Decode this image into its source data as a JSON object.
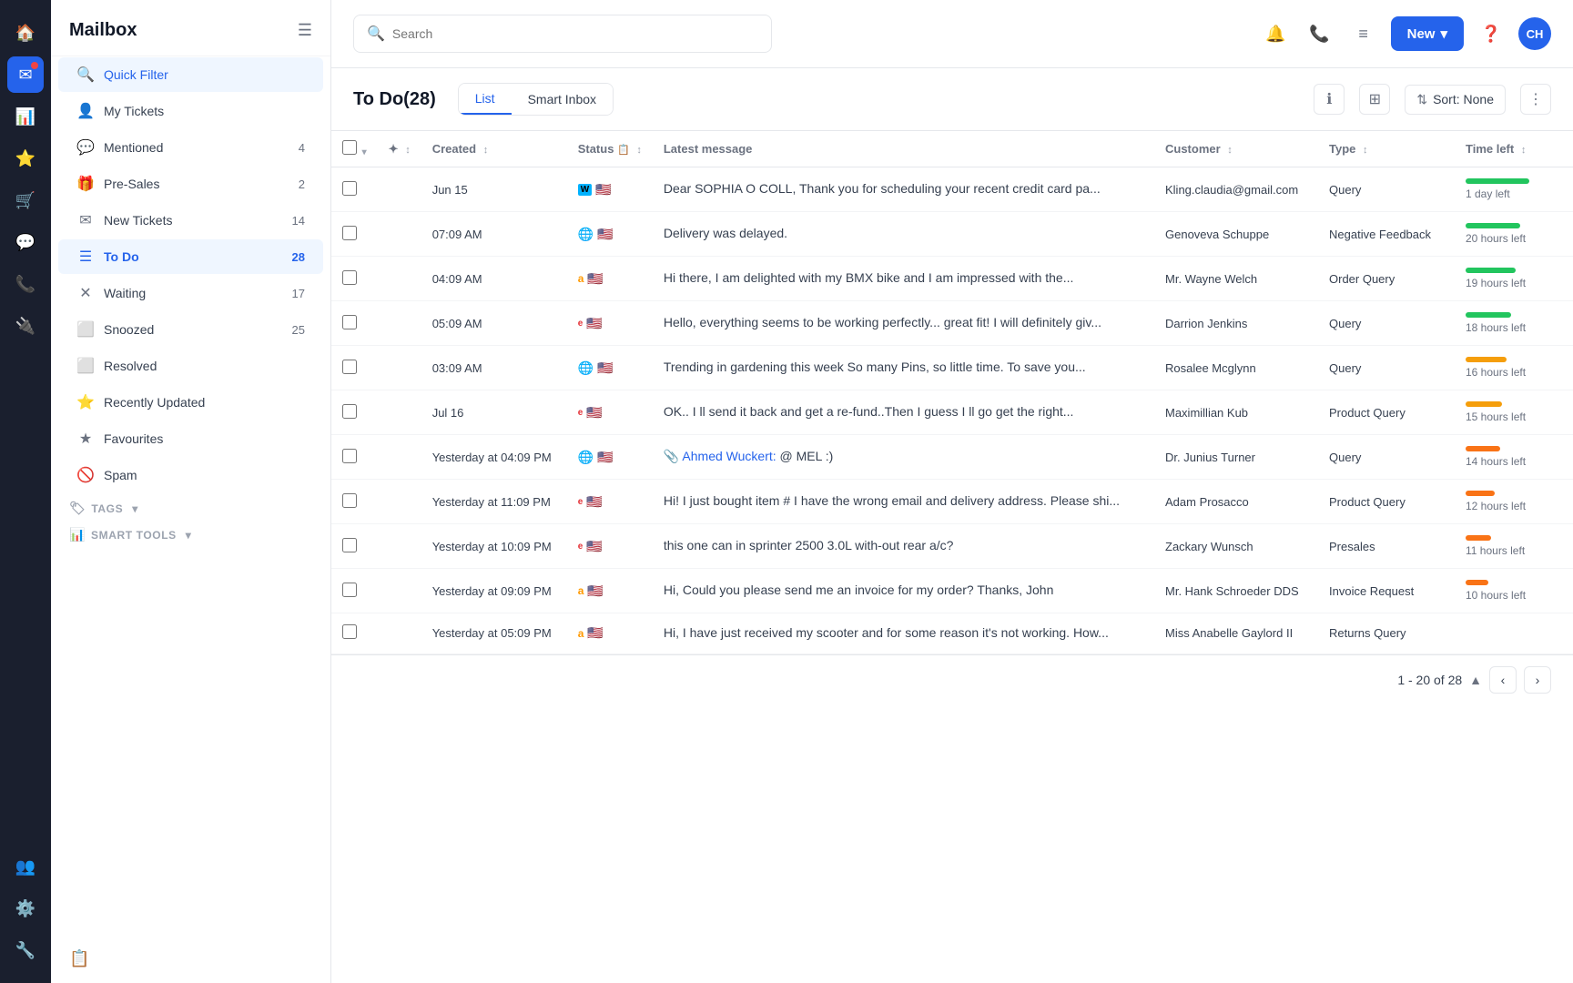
{
  "app": {
    "title": "Mailbox"
  },
  "sidebar": {
    "title": "Mailbox",
    "items": [
      {
        "id": "quick-filter",
        "label": "Quick Filter",
        "icon": "🔍",
        "count": "",
        "active": true
      },
      {
        "id": "my-tickets",
        "label": "My Tickets",
        "icon": "👤",
        "count": ""
      },
      {
        "id": "mentioned",
        "label": "Mentioned",
        "icon": "💬",
        "count": "4"
      },
      {
        "id": "pre-sales",
        "label": "Pre-Sales",
        "icon": "🎁",
        "count": "2"
      },
      {
        "id": "new-tickets",
        "label": "New Tickets",
        "icon": "✉️",
        "count": "14"
      },
      {
        "id": "to-do",
        "label": "To Do",
        "icon": "☰",
        "count": "28"
      },
      {
        "id": "waiting",
        "label": "Waiting",
        "icon": "✕",
        "count": "17"
      },
      {
        "id": "snoozed",
        "label": "Snoozed",
        "icon": "◻",
        "count": "25"
      },
      {
        "id": "resolved",
        "label": "Resolved",
        "icon": "◻",
        "count": ""
      },
      {
        "id": "recently-updated",
        "label": "Recently Updated",
        "icon": "⭐",
        "count": ""
      },
      {
        "id": "favourites",
        "label": "Favourites",
        "icon": "★",
        "count": ""
      },
      {
        "id": "spam",
        "label": "Spam",
        "icon": "🚫",
        "count": ""
      }
    ],
    "tags_label": "TAGS",
    "smart_tools_label": "SMART TOOLS"
  },
  "topbar": {
    "search_placeholder": "Search",
    "new_button": "New",
    "avatar_initials": "CH"
  },
  "content": {
    "title": "To Do",
    "count": "28",
    "view_list": "List",
    "view_smart_inbox": "Smart Inbox",
    "sort_label": "Sort: None"
  },
  "table": {
    "columns": [
      "Created",
      "Status",
      "Latest message",
      "Customer",
      "Type",
      "Time left"
    ],
    "rows": [
      {
        "created": "Jun 15",
        "source": "wix",
        "flag": "🇺🇸",
        "message": "Dear SOPHIA O COLL, Thank you for scheduling your recent credit card pa...",
        "customer": "Kling.claudia@gmail.com",
        "type": "Query",
        "time_left": "1 day left",
        "time_color": "green",
        "time_width": "70"
      },
      {
        "created": "07:09 AM",
        "source": "globe",
        "flag": "🇺🇸",
        "message": "Delivery was delayed.",
        "customer": "Genoveva Schuppe",
        "type": "Negative Feedback",
        "time_left": "20 hours left",
        "time_color": "green",
        "time_width": "60"
      },
      {
        "created": "04:09 AM",
        "source": "amazon",
        "flag": "🇺🇸",
        "message": "Hi there, I am delighted with my BMX bike and I am impressed with the...",
        "customer": "Mr. Wayne Welch",
        "type": "Order Query",
        "time_left": "19 hours left",
        "time_color": "green",
        "time_width": "55"
      },
      {
        "created": "05:09 AM",
        "source": "ebay",
        "flag": "🇺🇸",
        "message": "Hello, everything seems to be working perfectly... great fit! I will definitely giv...",
        "customer": "Darrion Jenkins",
        "type": "Query",
        "time_left": "18 hours left",
        "time_color": "green",
        "time_width": "50"
      },
      {
        "created": "03:09 AM",
        "source": "globe",
        "flag": "🇺🇸",
        "message": "Trending in gardening this week So many Pins, so little time. To save you...",
        "customer": "Rosalee Mcglynn",
        "type": "Query",
        "time_left": "16 hours left",
        "time_color": "yellow",
        "time_width": "45"
      },
      {
        "created": "Jul 16",
        "source": "ebay",
        "flag": "🇺🇸",
        "message": "OK.. I ll send it back and get a re-fund..Then I guess I ll go get the right...",
        "customer": "Maximillian Kub",
        "type": "Product Query",
        "time_left": "15 hours left",
        "time_color": "yellow",
        "time_width": "40"
      },
      {
        "created": "Yesterday at 04:09 PM",
        "source": "globe",
        "flag": "🇺🇸",
        "message": "Ahmed Wuckert: @ MEL :)",
        "message_sender": "Ahmed Wuckert:",
        "message_body": " @ MEL :)",
        "customer": "Dr. Junius Turner",
        "type": "Query",
        "time_left": "14 hours left",
        "time_color": "orange",
        "time_width": "38"
      },
      {
        "created": "Yesterday at 11:09 PM",
        "source": "ebay",
        "flag": "🇺🇸",
        "message": "Hi! I just bought item # I have the wrong email and delivery address. Please shi...",
        "customer": "Adam Prosacco",
        "type": "Product Query",
        "time_left": "12 hours left",
        "time_color": "orange",
        "time_width": "32"
      },
      {
        "created": "Yesterday at 10:09 PM",
        "source": "ebay",
        "flag": "🇺🇸",
        "message": "this one can in sprinter 2500 3.0L with-out rear a/c?",
        "customer": "Zackary Wunsch",
        "type": "Presales",
        "time_left": "11 hours left",
        "time_color": "orange",
        "time_width": "28"
      },
      {
        "created": "Yesterday at 09:09 PM",
        "source": "amazon",
        "flag": "🇺🇸",
        "message": "Hi, Could you please send me an invoice for my order? Thanks, John",
        "customer": "Mr. Hank Schroeder DDS",
        "type": "Invoice Request",
        "time_left": "10 hours left",
        "time_color": "orange",
        "time_width": "25"
      },
      {
        "created": "Yesterday at 05:09 PM",
        "source": "amazon",
        "flag": "🇺🇸",
        "message": "Hi, I have just received my scooter and for some reason it's not working. How...",
        "customer": "Miss Anabelle Gaylord II",
        "type": "Returns Query",
        "time_left": "",
        "time_color": "orange",
        "time_width": "20"
      }
    ]
  },
  "pagination": {
    "current": "1 - 20 of 28",
    "total_text": "20 of 28"
  }
}
